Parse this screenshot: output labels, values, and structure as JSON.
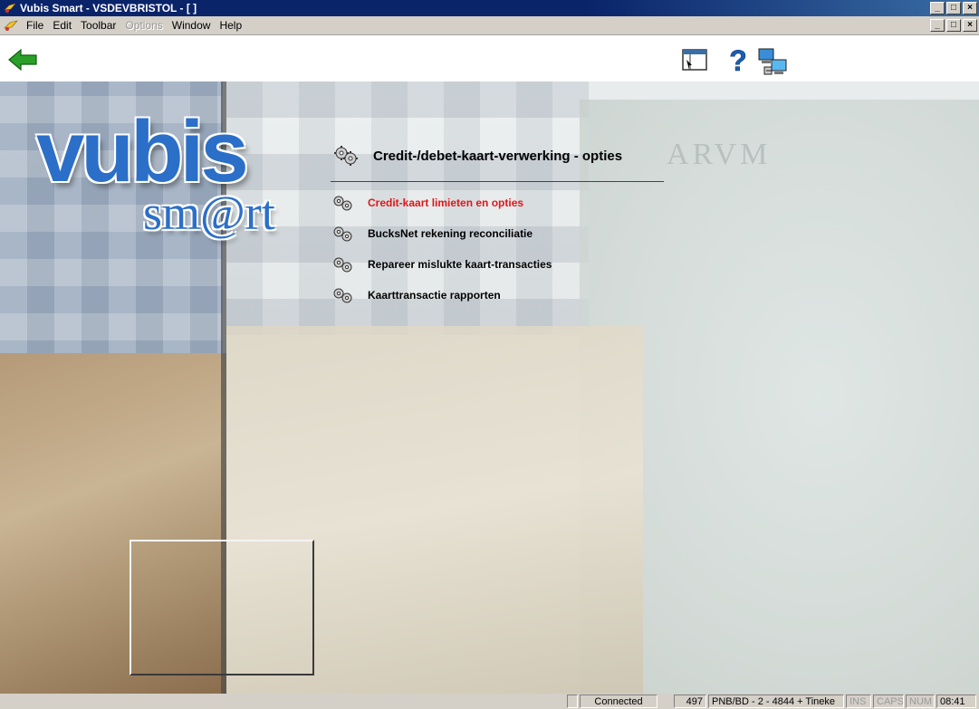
{
  "window": {
    "title": "Vubis Smart - VSDEVBRISTOL - [ ]",
    "controls": [
      "_",
      "´",
      "×"
    ]
  },
  "menubar": {
    "items": [
      {
        "label": "File",
        "enabled": true
      },
      {
        "label": "Edit",
        "enabled": true
      },
      {
        "label": "Toolbar",
        "enabled": true
      },
      {
        "label": "Options",
        "enabled": false
      },
      {
        "label": "Window",
        "enabled": true
      },
      {
        "label": "Help",
        "enabled": true
      }
    ]
  },
  "toolbar": {
    "back_icon": "back-arrow-icon",
    "icons": [
      "screen-icon",
      "help-icon",
      "network-icon"
    ],
    "help_glyph": "?"
  },
  "logo": {
    "main": "vubis",
    "sub": "sm@rt"
  },
  "background": {
    "map_label": "ARVM"
  },
  "panel": {
    "title": "Credit-/debet-kaart-verwerking - opties",
    "options": [
      {
        "label": "Credit-kaart limieten en opties",
        "active": true
      },
      {
        "label": "BucksNet rekening reconciliatie",
        "active": false
      },
      {
        "label": "Repareer mislukte kaart-transacties",
        "active": false
      },
      {
        "label": "Kaarttransactie rapporten",
        "active": false
      }
    ]
  },
  "statusbar": {
    "connection": "Connected",
    "number": "497",
    "session": "PNB/BD - 2 - 4844 + Tineke",
    "ins": "INS",
    "caps": "CAPS",
    "num": "NUM",
    "time": "08:41"
  },
  "colors": {
    "titlebar": "#0a246a",
    "active_option": "#e0161a",
    "logo_blue": "#2b6fc8",
    "back_arrow": "#2aa02a"
  }
}
